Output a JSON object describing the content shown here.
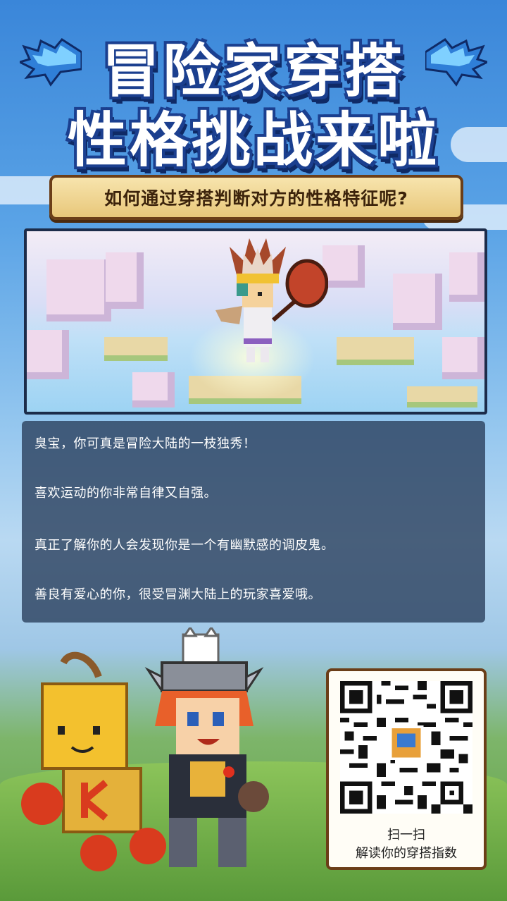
{
  "title": {
    "line1": "冒险家穿搭",
    "line2": "性格挑战来啦"
  },
  "banner": {
    "text": "如何通过穿搭判断对方的性格特征呢?"
  },
  "result": {
    "lines": [
      "臭宝，你可真是冒险大陆的一枝独秀！",
      "喜欢运动的你非常自律又自强。",
      "真正了解你的人会发现你是一个有幽默感的调皮鬼。",
      "善良有爱心的你，很受冒渊大陆上的玩家喜爱哦。"
    ]
  },
  "qr": {
    "caption_line1": "扫一扫",
    "caption_line2": "解读你的穿搭指数"
  },
  "colors": {
    "title_fill": "#ffffff",
    "title_outline": "#1b3f8f",
    "banner_bg": "#f2d898",
    "banner_border": "#6b3e18",
    "panel_bg": "#283c5a"
  }
}
